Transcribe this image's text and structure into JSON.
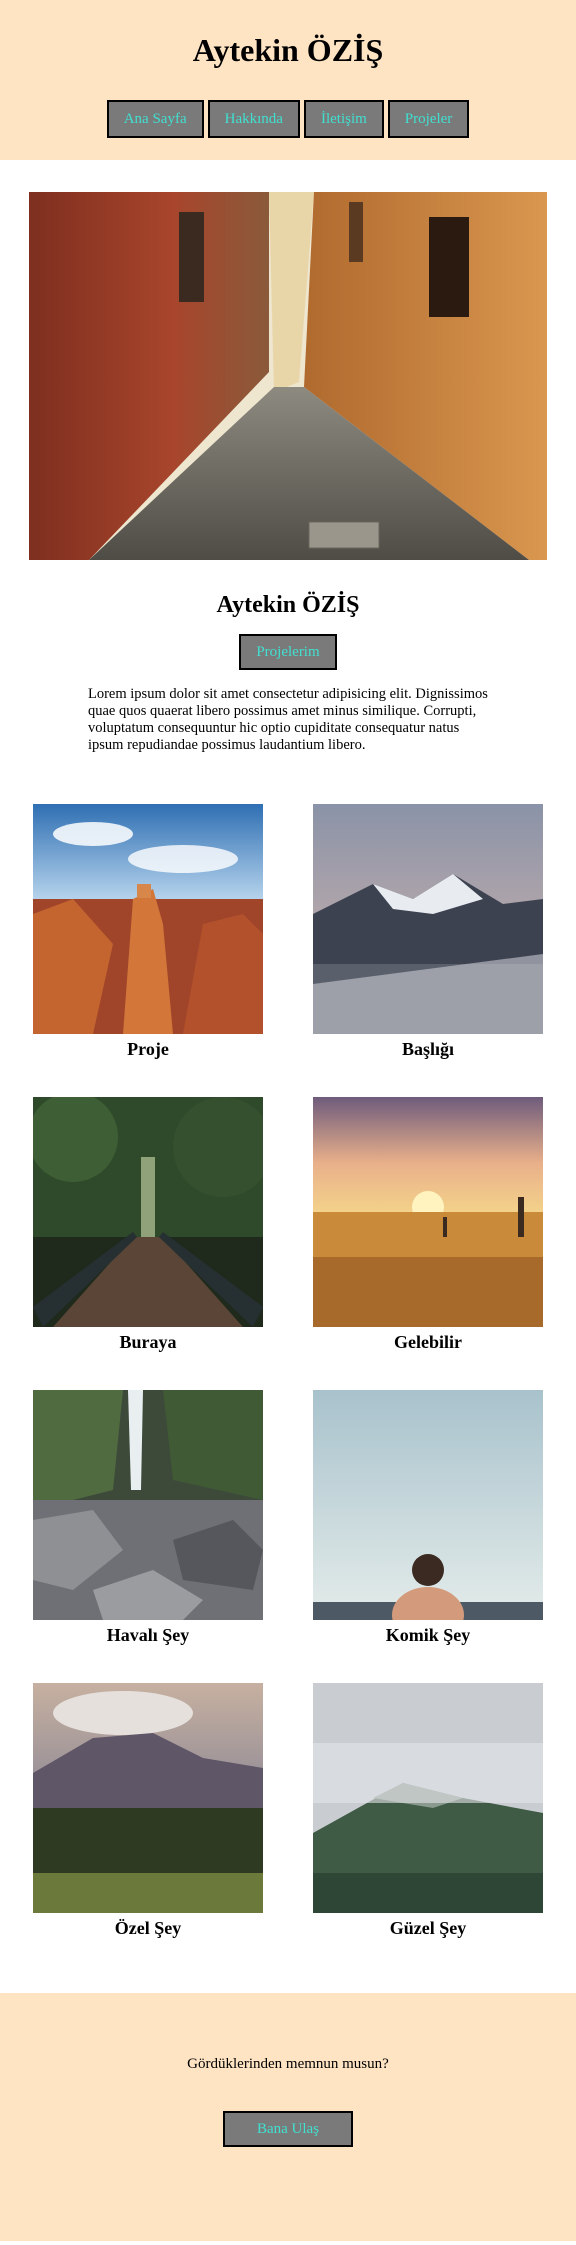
{
  "header": {
    "title": "Aytekin ÖZİŞ",
    "nav": [
      "Ana Sayfa",
      "Hakkında",
      "İletişim",
      "Projeler"
    ]
  },
  "intro": {
    "name": "Aytekin ÖZİŞ",
    "button_label": "Projelerim",
    "text": "Lorem ipsum dolor sit amet consectetur adipisicing elit. Dignissimos quae quos quaerat libero possimus amet minus similique. Corrupti, voluptatum consequuntur hic optio cupiditate consequatur natus ipsum repudiandae possimus laudantium libero."
  },
  "gallery": [
    {
      "caption": "Proje",
      "image": "canyon-hoodoos-photo"
    },
    {
      "caption": "Başlığı",
      "image": "snowy-mountain-photo"
    },
    {
      "caption": "Buraya",
      "image": "forest-bridge-photo"
    },
    {
      "caption": "Gelebilir",
      "image": "sunset-field-photo"
    },
    {
      "caption": "Havalı Şey",
      "image": "waterfall-rocks-photo"
    },
    {
      "caption": "Komik Şey",
      "image": "man-at-sea-photo"
    },
    {
      "caption": "Özel Şey",
      "image": "mountain-valley-photo"
    },
    {
      "caption": "Güzel Şey",
      "image": "misty-mountain-photo"
    }
  ],
  "footer": {
    "question": "Gördüklerinden memnun musun?",
    "button_label": "Bana Ulaş"
  },
  "colors": {
    "header_bg": "#ffe4c4",
    "button_bg": "#7a7a7a",
    "button_text": "#40e0d0"
  }
}
